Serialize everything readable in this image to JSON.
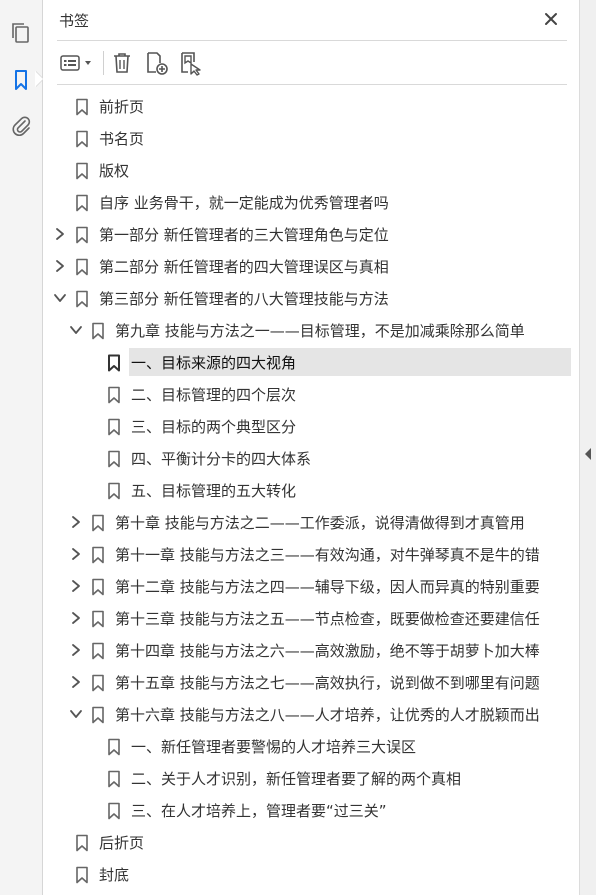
{
  "panel": {
    "title": "书签"
  },
  "rail": {
    "icons": [
      "pages-icon",
      "bookmark-icon",
      "attachment-icon"
    ],
    "accent": "#1473e6"
  },
  "toolbar": {
    "icons": [
      "options-menu-icon",
      "delete-icon",
      "new-bookmark-icon",
      "new-bookmark-from-structure-icon"
    ]
  },
  "bookmarks": [
    {
      "label": "前折页",
      "level": 0,
      "expander": "none"
    },
    {
      "label": "书名页",
      "level": 0,
      "expander": "none"
    },
    {
      "label": "版权",
      "level": 0,
      "expander": "none"
    },
    {
      "label": "自序 业务骨干，就一定能成为优秀管理者吗",
      "level": 0,
      "expander": "none"
    },
    {
      "label": "第一部分 新任管理者的三大管理角色与定位",
      "level": 0,
      "expander": "collapsed"
    },
    {
      "label": "第二部分 新任管理者的四大管理误区与真相",
      "level": 0,
      "expander": "collapsed"
    },
    {
      "label": "第三部分 新任管理者的八大管理技能与方法",
      "level": 0,
      "expander": "expanded"
    },
    {
      "label": "第九章 技能与方法之一——目标管理，不是加减乘除那么简单",
      "level": 1,
      "expander": "expanded"
    },
    {
      "label": "一、目标来源的四大视角",
      "level": 2,
      "expander": "none",
      "selected": true
    },
    {
      "label": "二、目标管理的四个层次",
      "level": 2,
      "expander": "none"
    },
    {
      "label": "三、目标的两个典型区分",
      "level": 2,
      "expander": "none"
    },
    {
      "label": "四、平衡计分卡的四大体系",
      "level": 2,
      "expander": "none"
    },
    {
      "label": "五、目标管理的五大转化",
      "level": 2,
      "expander": "none"
    },
    {
      "label": "第十章 技能与方法之二——工作委派，说得清做得到才真管用",
      "level": 1,
      "expander": "collapsed"
    },
    {
      "label": "第十一章 技能与方法之三——有效沟通，对牛弹琴真不是牛的错",
      "level": 1,
      "expander": "collapsed"
    },
    {
      "label": "第十二章 技能与方法之四——辅导下级，因人而异真的特别重要",
      "level": 1,
      "expander": "collapsed"
    },
    {
      "label": "第十三章 技能与方法之五——节点检查，既要做检查还要建信任",
      "level": 1,
      "expander": "collapsed"
    },
    {
      "label": "第十四章 技能与方法之六——高效激励，绝不等于胡萝卜加大棒",
      "level": 1,
      "expander": "collapsed"
    },
    {
      "label": "第十五章 技能与方法之七——高效执行，说到做不到哪里有问题",
      "level": 1,
      "expander": "collapsed"
    },
    {
      "label": "第十六章 技能与方法之八——人才培养，让优秀的人才脱颖而出",
      "level": 1,
      "expander": "expanded"
    },
    {
      "label": "一、新任管理者要警惕的人才培养三大误区",
      "level": 2,
      "expander": "none"
    },
    {
      "label": "二、关于人才识别，新任管理者要了解的两个真相",
      "level": 2,
      "expander": "none"
    },
    {
      "label": "三、在人才培养上，管理者要“过三关”",
      "level": 2,
      "expander": "none"
    },
    {
      "label": "后折页",
      "level": 0,
      "expander": "none"
    },
    {
      "label": "封底",
      "level": 0,
      "expander": "none"
    }
  ]
}
